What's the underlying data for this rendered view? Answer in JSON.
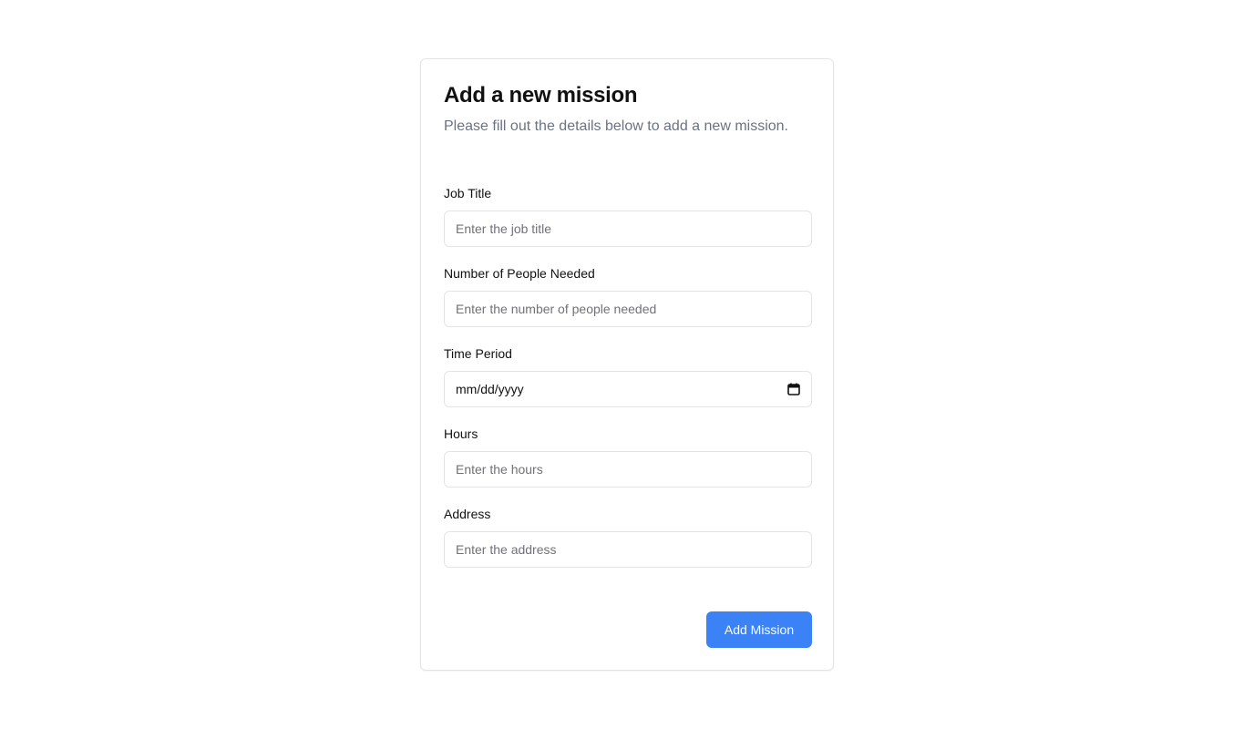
{
  "form": {
    "title": "Add a new mission",
    "subtitle": "Please fill out the details below to add a new mission.",
    "fields": {
      "job_title": {
        "label": "Job Title",
        "placeholder": "Enter the job title"
      },
      "people_needed": {
        "label": "Number of People Needed",
        "placeholder": "Enter the number of people needed"
      },
      "time_period": {
        "label": "Time Period",
        "value": "mm/dd/yyyy",
        "icon": "calendar-icon"
      },
      "hours": {
        "label": "Hours",
        "placeholder": "Enter the hours"
      },
      "address": {
        "label": "Address",
        "placeholder": "Enter the address"
      }
    },
    "submit_label": "Add Mission"
  },
  "colors": {
    "accent": "#3b82f6",
    "border": "#e4e4e7",
    "muted_text": "#6b7280",
    "text": "#111111"
  }
}
